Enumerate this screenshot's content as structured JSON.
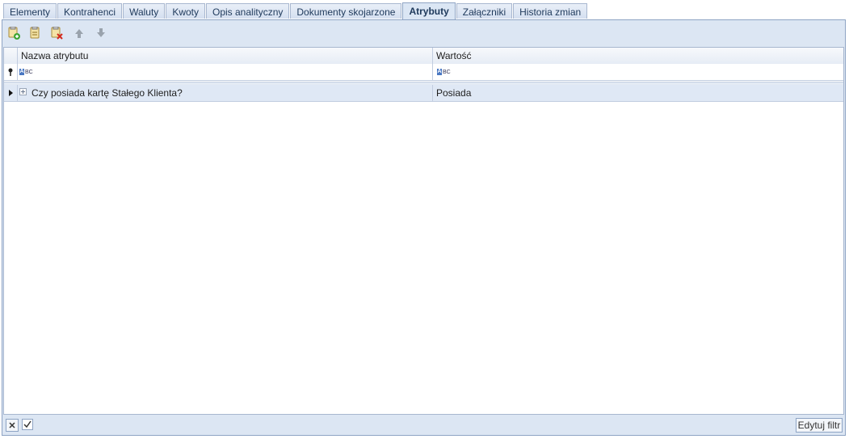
{
  "tabs": [
    {
      "label": "Elementy"
    },
    {
      "label": "Kontrahenci"
    },
    {
      "label": "Waluty"
    },
    {
      "label": "Kwoty"
    },
    {
      "label": "Opis analityczny"
    },
    {
      "label": "Dokumenty skojarzone"
    },
    {
      "label": "Atrybuty"
    },
    {
      "label": "Załączniki"
    },
    {
      "label": "Historia zmian"
    }
  ],
  "active_tab": "Atrybuty",
  "grid": {
    "columns": [
      "Nazwa atrybutu",
      "Wartość"
    ],
    "filter_marker": "ABC",
    "rows": [
      {
        "name": "Czy posiada kartę Stałego Klienta?",
        "value": "Posiada"
      }
    ]
  },
  "footer": {
    "edit_filter_label": "Edytuj filtr"
  },
  "colors": {
    "panel_bg": "#dce6f3",
    "selected_row": "#dfe8f5",
    "tab_text": "#1e395b"
  }
}
